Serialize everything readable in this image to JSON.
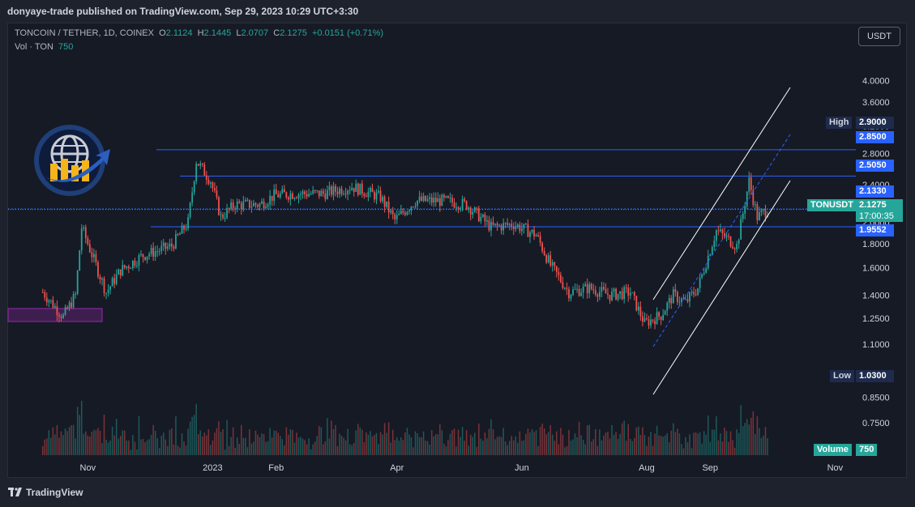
{
  "header": {
    "published": "donyaye-trade published on TradingView.com, Sep 29, 2023 10:29 UTC+3:30"
  },
  "legend": {
    "symbol": "TONCOIN / TETHER, 1D, COINEX",
    "open_label": "O",
    "open": "2.1124",
    "high_label": "H",
    "high": "2.1445",
    "low_label": "L",
    "low": "2.0707",
    "close_label": "C",
    "close": "2.1275",
    "change": "+0.0151 (+0.71%)",
    "vol_label": "Vol · TON",
    "vol_value": "750"
  },
  "currency_button": "USDT",
  "footer": {
    "brand": "TradingView"
  },
  "price_tags": {
    "high_label": "High",
    "high_value": "2.9000",
    "low_label": "Low",
    "low_value": "1.0300",
    "line_285": "2.8500",
    "line_2505": "2.5050",
    "line_2133": "2.1330",
    "line_19552": "1.9552",
    "symbol": "TONUSDT",
    "last": "2.1275",
    "countdown": "17:00:35",
    "volume_label": "Volume",
    "volume_value": "750"
  },
  "colors": {
    "up": "#26a69a",
    "down": "#ef5350",
    "level": "#2962ff",
    "bg": "#161a25",
    "channel": "#ffffff",
    "box": "#9c27b0"
  },
  "chart_data": {
    "type": "candlestick",
    "title": "TONCOIN / TETHER, 1D, COINEX",
    "y_scale": "log",
    "ylim": [
      0.78,
      4.2
    ],
    "y_ticks": [
      "4.0000",
      "3.6000",
      "3.2000",
      "2.8000",
      "2.4000",
      "2.0000",
      "1.8000",
      "1.6000",
      "1.4000",
      "1.2500",
      "1.1000",
      "0.9500",
      "0.8500",
      "0.7500"
    ],
    "x_ticks": [
      "Nov",
      "2023",
      "Feb",
      "Apr",
      "Jun",
      "Aug",
      "Sep",
      "Nov"
    ],
    "horizontal_levels": [
      2.85,
      2.505,
      2.133,
      1.9552
    ],
    "last_price": 2.1275,
    "period_high": 2.9,
    "period_low": 1.03,
    "close_path": [
      [
        "2022-10-10",
        1.42
      ],
      [
        "2022-10-20",
        1.26
      ],
      [
        "2022-10-26",
        1.4
      ],
      [
        "2022-10-29",
        1.95
      ],
      [
        "2022-11-05",
        1.62
      ],
      [
        "2022-11-10",
        1.42
      ],
      [
        "2022-11-17",
        1.58
      ],
      [
        "2022-11-28",
        1.7
      ],
      [
        "2022-12-12",
        1.78
      ],
      [
        "2022-12-20",
        2.0
      ],
      [
        "2022-12-24",
        2.7
      ],
      [
        "2022-12-31",
        2.45
      ],
      [
        "2023-01-05",
        2.05
      ],
      [
        "2023-01-12",
        2.18
      ],
      [
        "2023-01-24",
        2.18
      ],
      [
        "2023-01-31",
        2.28
      ],
      [
        "2023-02-10",
        2.3
      ],
      [
        "2023-02-24",
        2.3
      ],
      [
        "2023-03-10",
        2.38
      ],
      [
        "2023-03-24",
        2.26
      ],
      [
        "2023-03-31",
        2.02
      ],
      [
        "2023-04-10",
        2.22
      ],
      [
        "2023-04-24",
        2.22
      ],
      [
        "2023-05-05",
        2.18
      ],
      [
        "2023-05-17",
        1.95
      ],
      [
        "2023-05-28",
        1.98
      ],
      [
        "2023-06-08",
        1.88
      ],
      [
        "2023-06-15",
        1.62
      ],
      [
        "2023-06-24",
        1.42
      ],
      [
        "2023-07-04",
        1.45
      ],
      [
        "2023-07-14",
        1.4
      ],
      [
        "2023-07-24",
        1.42
      ],
      [
        "2023-07-31",
        1.22
      ],
      [
        "2023-08-08",
        1.27
      ],
      [
        "2023-08-14",
        1.4
      ],
      [
        "2023-08-20",
        1.35
      ],
      [
        "2023-08-26",
        1.45
      ],
      [
        "2023-09-04",
        1.92
      ],
      [
        "2023-09-14",
        1.78
      ],
      [
        "2023-09-20",
        2.45
      ],
      [
        "2023-09-24",
        2.05
      ],
      [
        "2023-09-29",
        2.1275
      ]
    ]
  }
}
